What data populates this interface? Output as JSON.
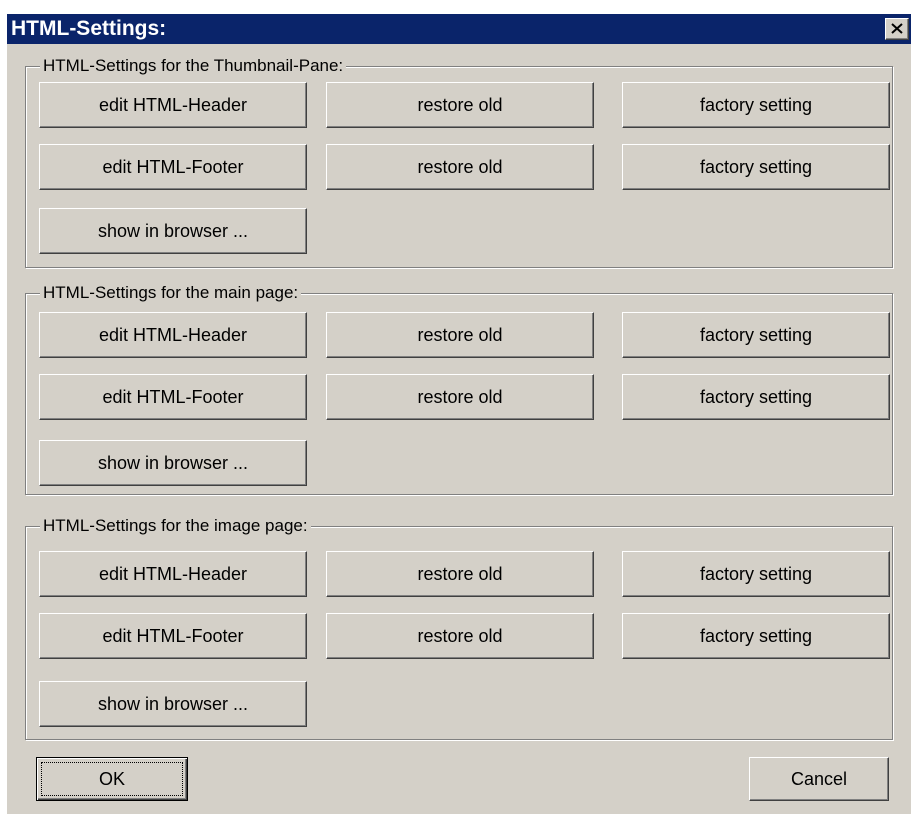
{
  "window": {
    "title": "HTML-Settings:"
  },
  "groups": [
    {
      "legend": "HTML-Settings for the Thumbnail-Pane:",
      "header_edit": "edit HTML-Header",
      "header_restore": "restore old",
      "header_factory": "factory setting",
      "footer_edit": "edit HTML-Footer",
      "footer_restore": "restore old",
      "footer_factory": "factory setting",
      "show": "show in browser ..."
    },
    {
      "legend": "HTML-Settings for the main page:",
      "header_edit": "edit HTML-Header",
      "header_restore": "restore old",
      "header_factory": "factory setting",
      "footer_edit": "edit HTML-Footer",
      "footer_restore": "restore old",
      "footer_factory": "factory setting",
      "show": "show in browser ..."
    },
    {
      "legend": "HTML-Settings for the image page:",
      "header_edit": "edit HTML-Header",
      "header_restore": "restore old",
      "header_factory": "factory setting",
      "footer_edit": "edit HTML-Footer",
      "footer_restore": "restore old",
      "footer_factory": "factory setting",
      "show": "show in browser ..."
    }
  ],
  "footer": {
    "ok": "OK",
    "cancel": "Cancel"
  }
}
